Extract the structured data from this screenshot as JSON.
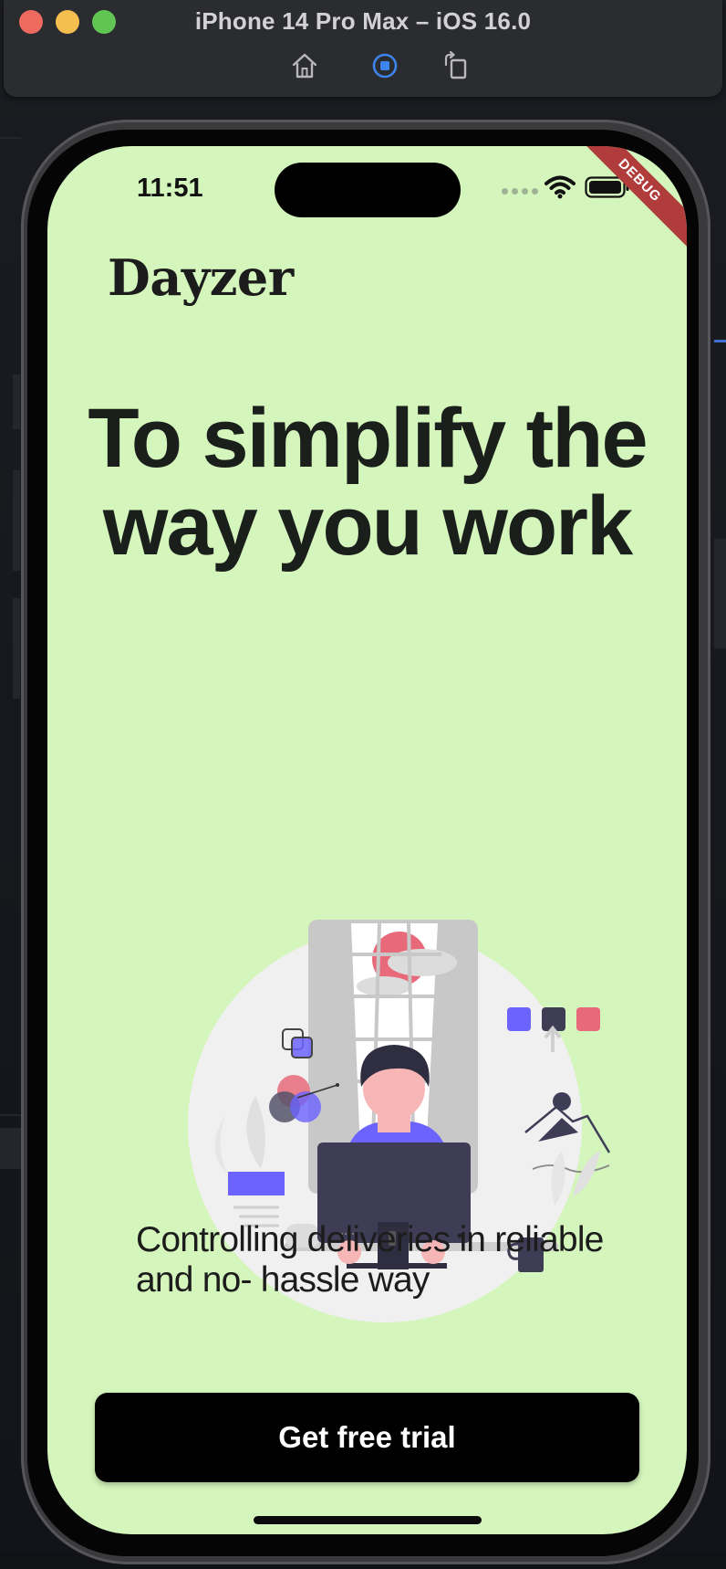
{
  "simulator": {
    "title": "iPhone 14 Pro Max – iOS 16.0",
    "toolbar": {
      "home": "home-icon",
      "screenshot": "screenshot-icon",
      "rotate": "rotate-icon"
    }
  },
  "status_bar": {
    "time": "11:51",
    "icons": [
      "signal-dots-icon",
      "wifi-icon",
      "battery-icon"
    ]
  },
  "debug_banner": "DEBUG",
  "app": {
    "brand": "Dayzer",
    "headline": "To simplify the way you work",
    "illustration": "person-working-at-computer-illustration",
    "subtitle": "Controlling deliveries in reliable and no- hassle way",
    "cta_label": "Get free trial"
  },
  "colors": {
    "screen_background": "#d4f5bc",
    "cta_background": "#000000",
    "accent_purple": "#6c63ff",
    "accent_pink": "#e86a7a",
    "debug_banner": "#b03d3b"
  }
}
